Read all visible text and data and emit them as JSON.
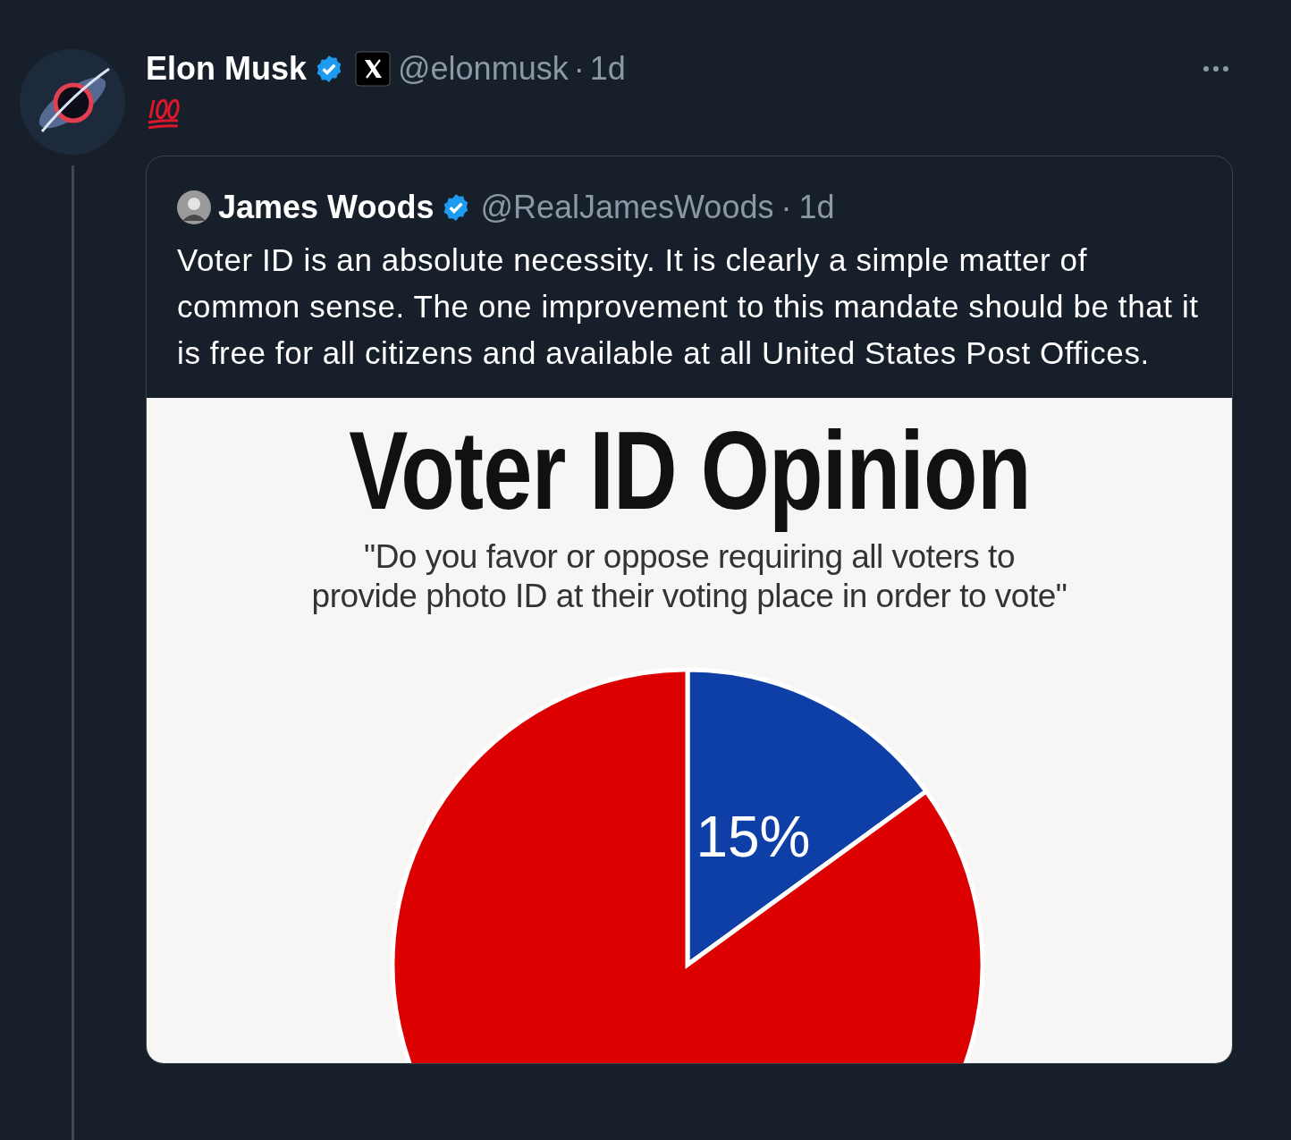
{
  "post": {
    "author": {
      "name": "Elon Musk",
      "verified": true,
      "handle": "@elonmusk",
      "separator": "·",
      "time": "1d"
    },
    "quote": {
      "author": {
        "name": "James Woods",
        "verified": true,
        "handle": "@RealJamesWoods",
        "separator": "·",
        "time": "1d"
      },
      "text": "Voter ID is an absolute necessity. It is clearly a simple matter of common sense. The one improvement to this mandate should be that it is free for all citizens and available at all United States Post Offices.",
      "image": {
        "subtitle_lines": [
          "\"Do you favor or oppose requiring all voters to",
          "provide photo ID at their voting place in order to vote\""
        ],
        "chart_data": {
          "type": "pie",
          "title": "Voter ID Opinion",
          "values": [
            15,
            85
          ],
          "colors": [
            "#0d3fa6",
            "#dd0000"
          ],
          "value_labels": [
            "15%",
            null
          ]
        }
      }
    }
  }
}
